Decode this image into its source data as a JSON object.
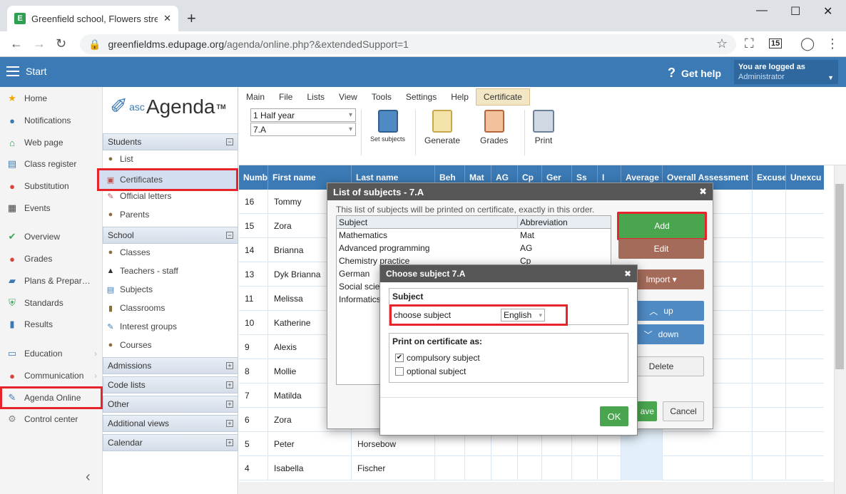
{
  "browser": {
    "tab_title": "Greenfield school, Flowers street",
    "tab_favicon": "E",
    "url_host": "greenfieldms.edupage.org",
    "url_path": "/agenda/online.php?&extendedSupport=1",
    "new_tab": "+",
    "calendar_badge": "15"
  },
  "app": {
    "start_label": "Start",
    "help_label": "Get help",
    "user_line1": "You are logged as",
    "user_line2": "Administrator"
  },
  "leftnav": [
    {
      "label": "Home",
      "icon": "star-icon"
    },
    {
      "label": "Notifications",
      "icon": "notifications-icon"
    },
    {
      "label": "Web page",
      "icon": "home-icon"
    },
    {
      "label": "Class register",
      "icon": "register-icon"
    },
    {
      "label": "Substitution",
      "icon": "substitution-icon"
    },
    {
      "label": "Events",
      "icon": "calendar-icon"
    },
    {
      "label": "Overview",
      "icon": "check-icon"
    },
    {
      "label": "Grades",
      "icon": "grades-icon"
    },
    {
      "label": "Plans & Prepar…",
      "icon": "briefcase-icon"
    },
    {
      "label": "Standards",
      "icon": "shield-icon"
    },
    {
      "label": "Results",
      "icon": "chart-icon"
    },
    {
      "label": "Education",
      "icon": "book-icon"
    },
    {
      "label": "Communication",
      "icon": "chat-icon"
    },
    {
      "label": "Agenda Online",
      "icon": "agenda-icon"
    },
    {
      "label": "Control center",
      "icon": "gear-icon"
    }
  ],
  "panel2": {
    "logo_asc": "asc",
    "logo_main": "Agenda",
    "logo_tm": "TM",
    "sections": {
      "students": "Students",
      "school": "School",
      "admissions": "Admissions",
      "code_lists": "Code lists",
      "other": "Other",
      "additional_views": "Additional views",
      "calendar": "Calendar"
    },
    "students_items": [
      "List",
      "Certificates",
      "Official letters",
      "Parents"
    ],
    "school_items": [
      "Classes",
      "Teachers - staff",
      "Subjects",
      "Classrooms",
      "Interest groups",
      "Courses"
    ]
  },
  "menu": [
    "Main",
    "File",
    "Lists",
    "View",
    "Tools",
    "Settings",
    "Help",
    "Certificate"
  ],
  "toolbar": {
    "period_select": "1 Half year",
    "class_select": "7.A",
    "set_subjects": "Set subjects",
    "generate": "Generate",
    "grades": "Grades",
    "print": "Print"
  },
  "grid": {
    "headers": [
      "Numb",
      "First name",
      "Last name",
      "Beh",
      "Mat",
      "AG",
      "Cp",
      "Ger",
      "Ss",
      "I",
      "Average",
      "Overall Assessment",
      "Excuse",
      "Unexcu"
    ],
    "rows": [
      {
        "num": "16",
        "first": "Tommy",
        "last": ""
      },
      {
        "num": "15",
        "first": "Zora",
        "last": ""
      },
      {
        "num": "14",
        "first": "Brianna",
        "last": ""
      },
      {
        "num": "13",
        "first": "Dyk Brianna",
        "last": ""
      },
      {
        "num": "11",
        "first": "Melissa",
        "last": ""
      },
      {
        "num": "10",
        "first": "Katherine",
        "last": ""
      },
      {
        "num": "9",
        "first": "Alexis",
        "last": ""
      },
      {
        "num": "8",
        "first": "Mollie",
        "last": ""
      },
      {
        "num": "7",
        "first": "Matilda",
        "last": ""
      },
      {
        "num": "6",
        "first": "Zora",
        "last": ""
      },
      {
        "num": "5",
        "first": "Peter",
        "last": "Horsebow"
      },
      {
        "num": "4",
        "first": "Isabella",
        "last": "Fischer"
      }
    ]
  },
  "dialog_list": {
    "title": "List of subjects - 7.A",
    "description": "This list of subjects will be printed on certificate, exactly in this order.",
    "col_subject": "Subject",
    "col_abbr": "Abbreviation",
    "rows": [
      {
        "subject": "Mathematics",
        "abbr": "Mat"
      },
      {
        "subject": "Advanced programming",
        "abbr": "AG"
      },
      {
        "subject": "Chemistry practice",
        "abbr": "Cp"
      },
      {
        "subject": "German",
        "abbr": ""
      },
      {
        "subject": "Social scie",
        "abbr": ""
      },
      {
        "subject": "Informatics",
        "abbr": ""
      }
    ],
    "add": "Add",
    "edit": "Edit",
    "import": "Import ▾",
    "up": "up",
    "down": "down",
    "delete": "Delete",
    "save": "ave",
    "cancel": "Cancel"
  },
  "dialog_choose": {
    "title": "Choose subject 7.A",
    "subject_legend": "Subject",
    "choose_label": "choose subject",
    "choose_value": "English",
    "print_legend": "Print on certificate as:",
    "compulsory": "compulsory subject",
    "optional": "optional subject",
    "compulsory_checked": true,
    "optional_checked": false,
    "ok": "OK"
  },
  "colors": {
    "header_blue": "#3b7ab5",
    "highlight_red": "#e8242b",
    "green": "#4aa64e"
  }
}
